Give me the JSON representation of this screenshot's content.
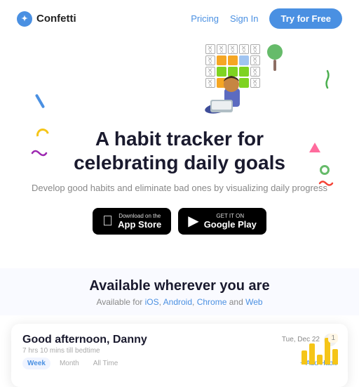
{
  "nav": {
    "logo_text": "Confetti",
    "pricing_label": "Pricing",
    "signin_label": "Sign In",
    "try_free_label": "Try for Free"
  },
  "hero": {
    "headline_line1": "A habit tracker for",
    "headline_line2": "celebrating daily goals",
    "subtext": "Develop good habits and eliminate bad ones by visualizing daily progress",
    "app_store_badge": {
      "top_text": "Download on the",
      "main_text": "App Store"
    },
    "google_play_badge": {
      "top_text": "GET IT ON",
      "main_text": "Google Play"
    }
  },
  "available": {
    "heading": "Available wherever you are",
    "sub_prefix": "Available for ",
    "platforms": [
      {
        "label": "iOS",
        "color": "#4a90e2"
      },
      {
        "label": "Android",
        "color": "#4a90e2"
      },
      {
        "label": "Chrome",
        "color": "#4a90e2"
      },
      {
        "label": "Web",
        "color": "#4a90e2"
      }
    ]
  },
  "dashboard": {
    "greeting": "Good afternoon, Danny",
    "sub": "7 hrs 10 mins till bedtime",
    "date": "Tue, Dec 22",
    "tabs": [
      "Week",
      "Month",
      "All Time"
    ],
    "active_tab": "Week",
    "add_habit": "+ Add Habit"
  },
  "decorations": {
    "blue_line": true,
    "yellow_arc": true,
    "purple_squiggle": true,
    "green_zigzag": true,
    "pink_triangle": true,
    "green_circle": true,
    "red_squiggle": true
  }
}
